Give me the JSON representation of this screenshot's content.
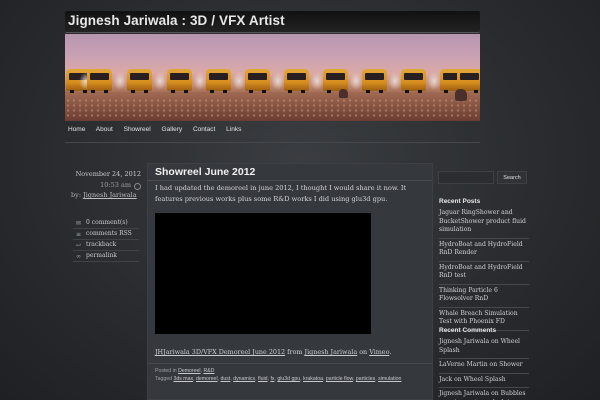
{
  "site": {
    "title": "Jignesh Jariwala : 3D / VFX Artist"
  },
  "nav": [
    "Home",
    "About",
    "Showreel",
    "Gallery",
    "Contact",
    "Links"
  ],
  "meta": {
    "date": "November 24, 2012",
    "time": "10:53 am",
    "by_prefix": "by:",
    "author": "Jignesh Jariwala",
    "links": [
      {
        "icon": "comment-icon",
        "glyph": "✉",
        "label": "0 comment(s)"
      },
      {
        "icon": "rss-icon",
        "glyph": "≡",
        "label": "comments RSS"
      },
      {
        "icon": "trackback-icon",
        "glyph": "↩",
        "label": "trackback"
      },
      {
        "icon": "link-icon",
        "glyph": "∞",
        "label": "permalink"
      }
    ]
  },
  "post": {
    "title": "Showreel June 2012",
    "body": "I had updated the demoreel in june 2012, I thought I would share it now. It features previous works plus some R&D works I did using glu3d gpu.",
    "credit": {
      "video_link": "JHJariwala 3D/VFX Demoreel June 2012",
      "from": " from ",
      "author_link": "Jignesh Jariwala",
      "on": " on ",
      "site_link": "Vimeo",
      "period": "."
    },
    "posted_in_prefix": "Posted in ",
    "categories": [
      "Demoreel",
      "R&D"
    ],
    "tagged_prefix": "Tagged ",
    "tags": [
      "3ds max",
      "demoreel",
      "dust",
      "dynamics",
      "fluid",
      "fx",
      "glu3d gpu",
      "krakatoa",
      "particle flow",
      "particles",
      "simulation"
    ]
  },
  "sidebar": {
    "search_button": "Search",
    "recent_posts_heading": "Recent Posts",
    "recent_posts": [
      "Jaguar RingShower and BucketShower product fluid simulation",
      "HydroBoat and HydroField RnD Render",
      "HydroBoat and HydroField RnD test",
      "Thinking Particle 6 Flowsolver RnD",
      "Whale Breach Simulation Test with Phoenix FD"
    ],
    "recent_comments_heading": "Recent Comments",
    "recent_comments": [
      "Jignesh Jariwala on Wheel Splash",
      "LaVerne Martin on Shower",
      "Jack on Wheel Splash",
      "Jignesh Jariwala on Bubbles popping water splash in super slow motion"
    ]
  },
  "colors": {
    "background": "#2a2c2f",
    "post_panel": "#35383c",
    "bus_orange": "#d78f1f"
  }
}
